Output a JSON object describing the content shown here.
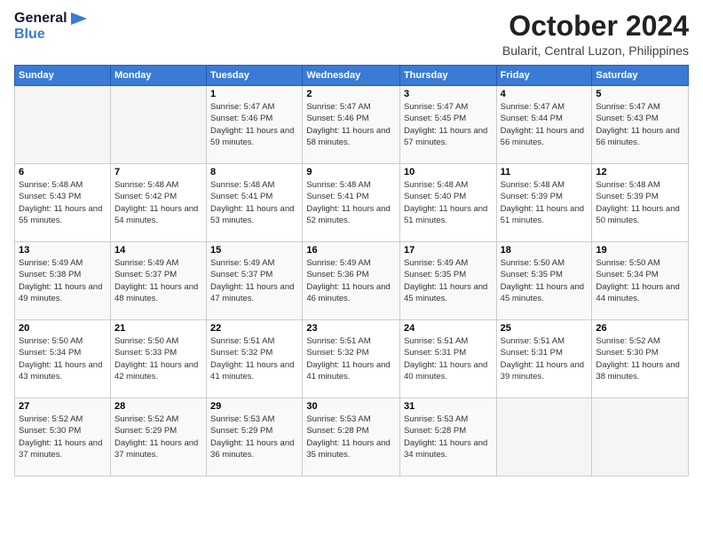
{
  "logo": {
    "line1": "General",
    "line2": "Blue"
  },
  "title": "October 2024",
  "location": "Bularit, Central Luzon, Philippines",
  "weekdays": [
    "Sunday",
    "Monday",
    "Tuesday",
    "Wednesday",
    "Thursday",
    "Friday",
    "Saturday"
  ],
  "weeks": [
    [
      {
        "day": "",
        "info": ""
      },
      {
        "day": "",
        "info": ""
      },
      {
        "day": "1",
        "sunrise": "Sunrise: 5:47 AM",
        "sunset": "Sunset: 5:46 PM",
        "daylight": "Daylight: 11 hours and 59 minutes."
      },
      {
        "day": "2",
        "sunrise": "Sunrise: 5:47 AM",
        "sunset": "Sunset: 5:46 PM",
        "daylight": "Daylight: 11 hours and 58 minutes."
      },
      {
        "day": "3",
        "sunrise": "Sunrise: 5:47 AM",
        "sunset": "Sunset: 5:45 PM",
        "daylight": "Daylight: 11 hours and 57 minutes."
      },
      {
        "day": "4",
        "sunrise": "Sunrise: 5:47 AM",
        "sunset": "Sunset: 5:44 PM",
        "daylight": "Daylight: 11 hours and 56 minutes."
      },
      {
        "day": "5",
        "sunrise": "Sunrise: 5:47 AM",
        "sunset": "Sunset: 5:43 PM",
        "daylight": "Daylight: 11 hours and 56 minutes."
      }
    ],
    [
      {
        "day": "6",
        "sunrise": "Sunrise: 5:48 AM",
        "sunset": "Sunset: 5:43 PM",
        "daylight": "Daylight: 11 hours and 55 minutes."
      },
      {
        "day": "7",
        "sunrise": "Sunrise: 5:48 AM",
        "sunset": "Sunset: 5:42 PM",
        "daylight": "Daylight: 11 hours and 54 minutes."
      },
      {
        "day": "8",
        "sunrise": "Sunrise: 5:48 AM",
        "sunset": "Sunset: 5:41 PM",
        "daylight": "Daylight: 11 hours and 53 minutes."
      },
      {
        "day": "9",
        "sunrise": "Sunrise: 5:48 AM",
        "sunset": "Sunset: 5:41 PM",
        "daylight": "Daylight: 11 hours and 52 minutes."
      },
      {
        "day": "10",
        "sunrise": "Sunrise: 5:48 AM",
        "sunset": "Sunset: 5:40 PM",
        "daylight": "Daylight: 11 hours and 51 minutes."
      },
      {
        "day": "11",
        "sunrise": "Sunrise: 5:48 AM",
        "sunset": "Sunset: 5:39 PM",
        "daylight": "Daylight: 11 hours and 51 minutes."
      },
      {
        "day": "12",
        "sunrise": "Sunrise: 5:48 AM",
        "sunset": "Sunset: 5:39 PM",
        "daylight": "Daylight: 11 hours and 50 minutes."
      }
    ],
    [
      {
        "day": "13",
        "sunrise": "Sunrise: 5:49 AM",
        "sunset": "Sunset: 5:38 PM",
        "daylight": "Daylight: 11 hours and 49 minutes."
      },
      {
        "day": "14",
        "sunrise": "Sunrise: 5:49 AM",
        "sunset": "Sunset: 5:37 PM",
        "daylight": "Daylight: 11 hours and 48 minutes."
      },
      {
        "day": "15",
        "sunrise": "Sunrise: 5:49 AM",
        "sunset": "Sunset: 5:37 PM",
        "daylight": "Daylight: 11 hours and 47 minutes."
      },
      {
        "day": "16",
        "sunrise": "Sunrise: 5:49 AM",
        "sunset": "Sunset: 5:36 PM",
        "daylight": "Daylight: 11 hours and 46 minutes."
      },
      {
        "day": "17",
        "sunrise": "Sunrise: 5:49 AM",
        "sunset": "Sunset: 5:35 PM",
        "daylight": "Daylight: 11 hours and 45 minutes."
      },
      {
        "day": "18",
        "sunrise": "Sunrise: 5:50 AM",
        "sunset": "Sunset: 5:35 PM",
        "daylight": "Daylight: 11 hours and 45 minutes."
      },
      {
        "day": "19",
        "sunrise": "Sunrise: 5:50 AM",
        "sunset": "Sunset: 5:34 PM",
        "daylight": "Daylight: 11 hours and 44 minutes."
      }
    ],
    [
      {
        "day": "20",
        "sunrise": "Sunrise: 5:50 AM",
        "sunset": "Sunset: 5:34 PM",
        "daylight": "Daylight: 11 hours and 43 minutes."
      },
      {
        "day": "21",
        "sunrise": "Sunrise: 5:50 AM",
        "sunset": "Sunset: 5:33 PM",
        "daylight": "Daylight: 11 hours and 42 minutes."
      },
      {
        "day": "22",
        "sunrise": "Sunrise: 5:51 AM",
        "sunset": "Sunset: 5:32 PM",
        "daylight": "Daylight: 11 hours and 41 minutes."
      },
      {
        "day": "23",
        "sunrise": "Sunrise: 5:51 AM",
        "sunset": "Sunset: 5:32 PM",
        "daylight": "Daylight: 11 hours and 41 minutes."
      },
      {
        "day": "24",
        "sunrise": "Sunrise: 5:51 AM",
        "sunset": "Sunset: 5:31 PM",
        "daylight": "Daylight: 11 hours and 40 minutes."
      },
      {
        "day": "25",
        "sunrise": "Sunrise: 5:51 AM",
        "sunset": "Sunset: 5:31 PM",
        "daylight": "Daylight: 11 hours and 39 minutes."
      },
      {
        "day": "26",
        "sunrise": "Sunrise: 5:52 AM",
        "sunset": "Sunset: 5:30 PM",
        "daylight": "Daylight: 11 hours and 38 minutes."
      }
    ],
    [
      {
        "day": "27",
        "sunrise": "Sunrise: 5:52 AM",
        "sunset": "Sunset: 5:30 PM",
        "daylight": "Daylight: 11 hours and 37 minutes."
      },
      {
        "day": "28",
        "sunrise": "Sunrise: 5:52 AM",
        "sunset": "Sunset: 5:29 PM",
        "daylight": "Daylight: 11 hours and 37 minutes."
      },
      {
        "day": "29",
        "sunrise": "Sunrise: 5:53 AM",
        "sunset": "Sunset: 5:29 PM",
        "daylight": "Daylight: 11 hours and 36 minutes."
      },
      {
        "day": "30",
        "sunrise": "Sunrise: 5:53 AM",
        "sunset": "Sunset: 5:28 PM",
        "daylight": "Daylight: 11 hours and 35 minutes."
      },
      {
        "day": "31",
        "sunrise": "Sunrise: 5:53 AM",
        "sunset": "Sunset: 5:28 PM",
        "daylight": "Daylight: 11 hours and 34 minutes."
      },
      {
        "day": "",
        "info": ""
      },
      {
        "day": "",
        "info": ""
      }
    ]
  ]
}
